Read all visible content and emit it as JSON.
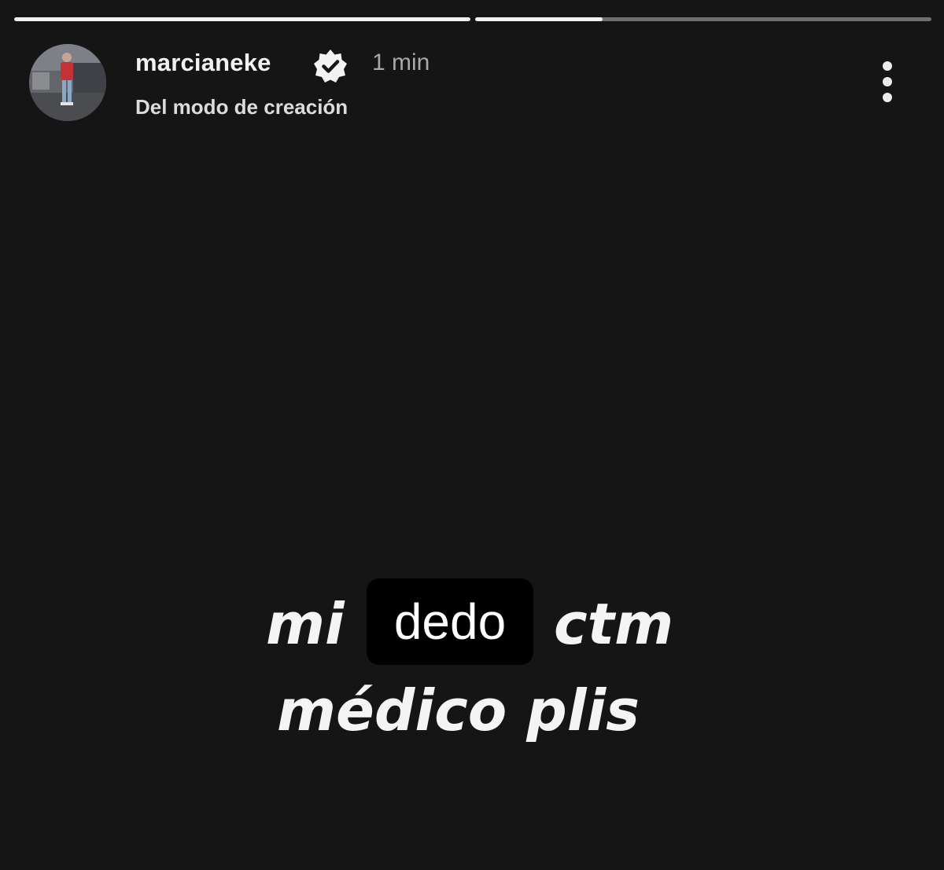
{
  "story": {
    "progress": [
      1.0,
      0.28
    ],
    "user": {
      "username": "marcianeke",
      "verified": true,
      "timestamp": "1 min",
      "subtitle": "Del modo de creación"
    },
    "text_lines": [
      "mi",
      "ctm",
      "médico plis"
    ],
    "sticker_text": "dedo"
  },
  "icons": {
    "verified": "verified-badge-icon",
    "menu": "more-options-icon"
  },
  "colors": {
    "background": "#151515",
    "progress_track": "#6f6f6f",
    "progress_fill": "#f1f1f1",
    "text_primary": "#f2f2f2",
    "text_secondary": "#a8a8a8",
    "sticker_background": "#000000"
  }
}
